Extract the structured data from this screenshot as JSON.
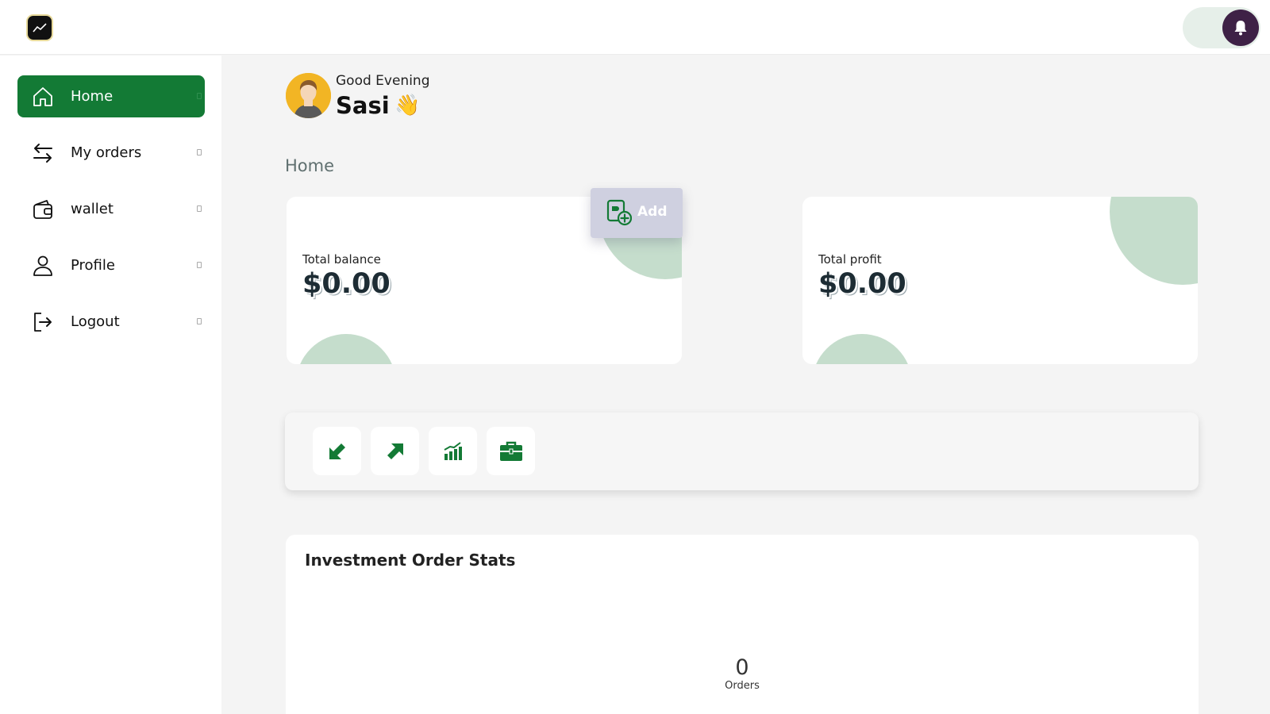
{
  "header": {
    "logo_icon": "trend-chart-icon",
    "theme_toggle": "theme-toggle",
    "notification_icon": "bell-icon"
  },
  "sidebar": {
    "items": [
      {
        "label": "Home",
        "icon": "home-icon",
        "active": true
      },
      {
        "label": "My orders",
        "icon": "arrows-swap-icon",
        "active": false
      },
      {
        "label": "wallet",
        "icon": "wallet-icon",
        "active": false
      },
      {
        "label": "Profile",
        "icon": "user-icon",
        "active": false
      },
      {
        "label": "Logout",
        "icon": "logout-icon",
        "active": false
      }
    ]
  },
  "greeting": {
    "salutation": "Good Evening",
    "name": "Sasi",
    "emoji": "👋"
  },
  "page": {
    "title": "Home"
  },
  "cards": {
    "balance": {
      "label": "Total balance",
      "value": "$0.00"
    },
    "profit": {
      "label": "Total profit",
      "value": "$0.00"
    },
    "add_button": {
      "label": "Add"
    }
  },
  "actions": [
    {
      "icon": "arrow-down-left-icon"
    },
    {
      "icon": "arrow-up-right-icon"
    },
    {
      "icon": "bar-chart-icon"
    },
    {
      "icon": "briefcase-icon"
    }
  ],
  "stats": {
    "title": "Investment Order Stats",
    "count": "0",
    "unit": "Orders"
  },
  "colors": {
    "accent": "#137a35",
    "accent_light": "#c5ddcc",
    "notification_bg": "#3e2146"
  }
}
